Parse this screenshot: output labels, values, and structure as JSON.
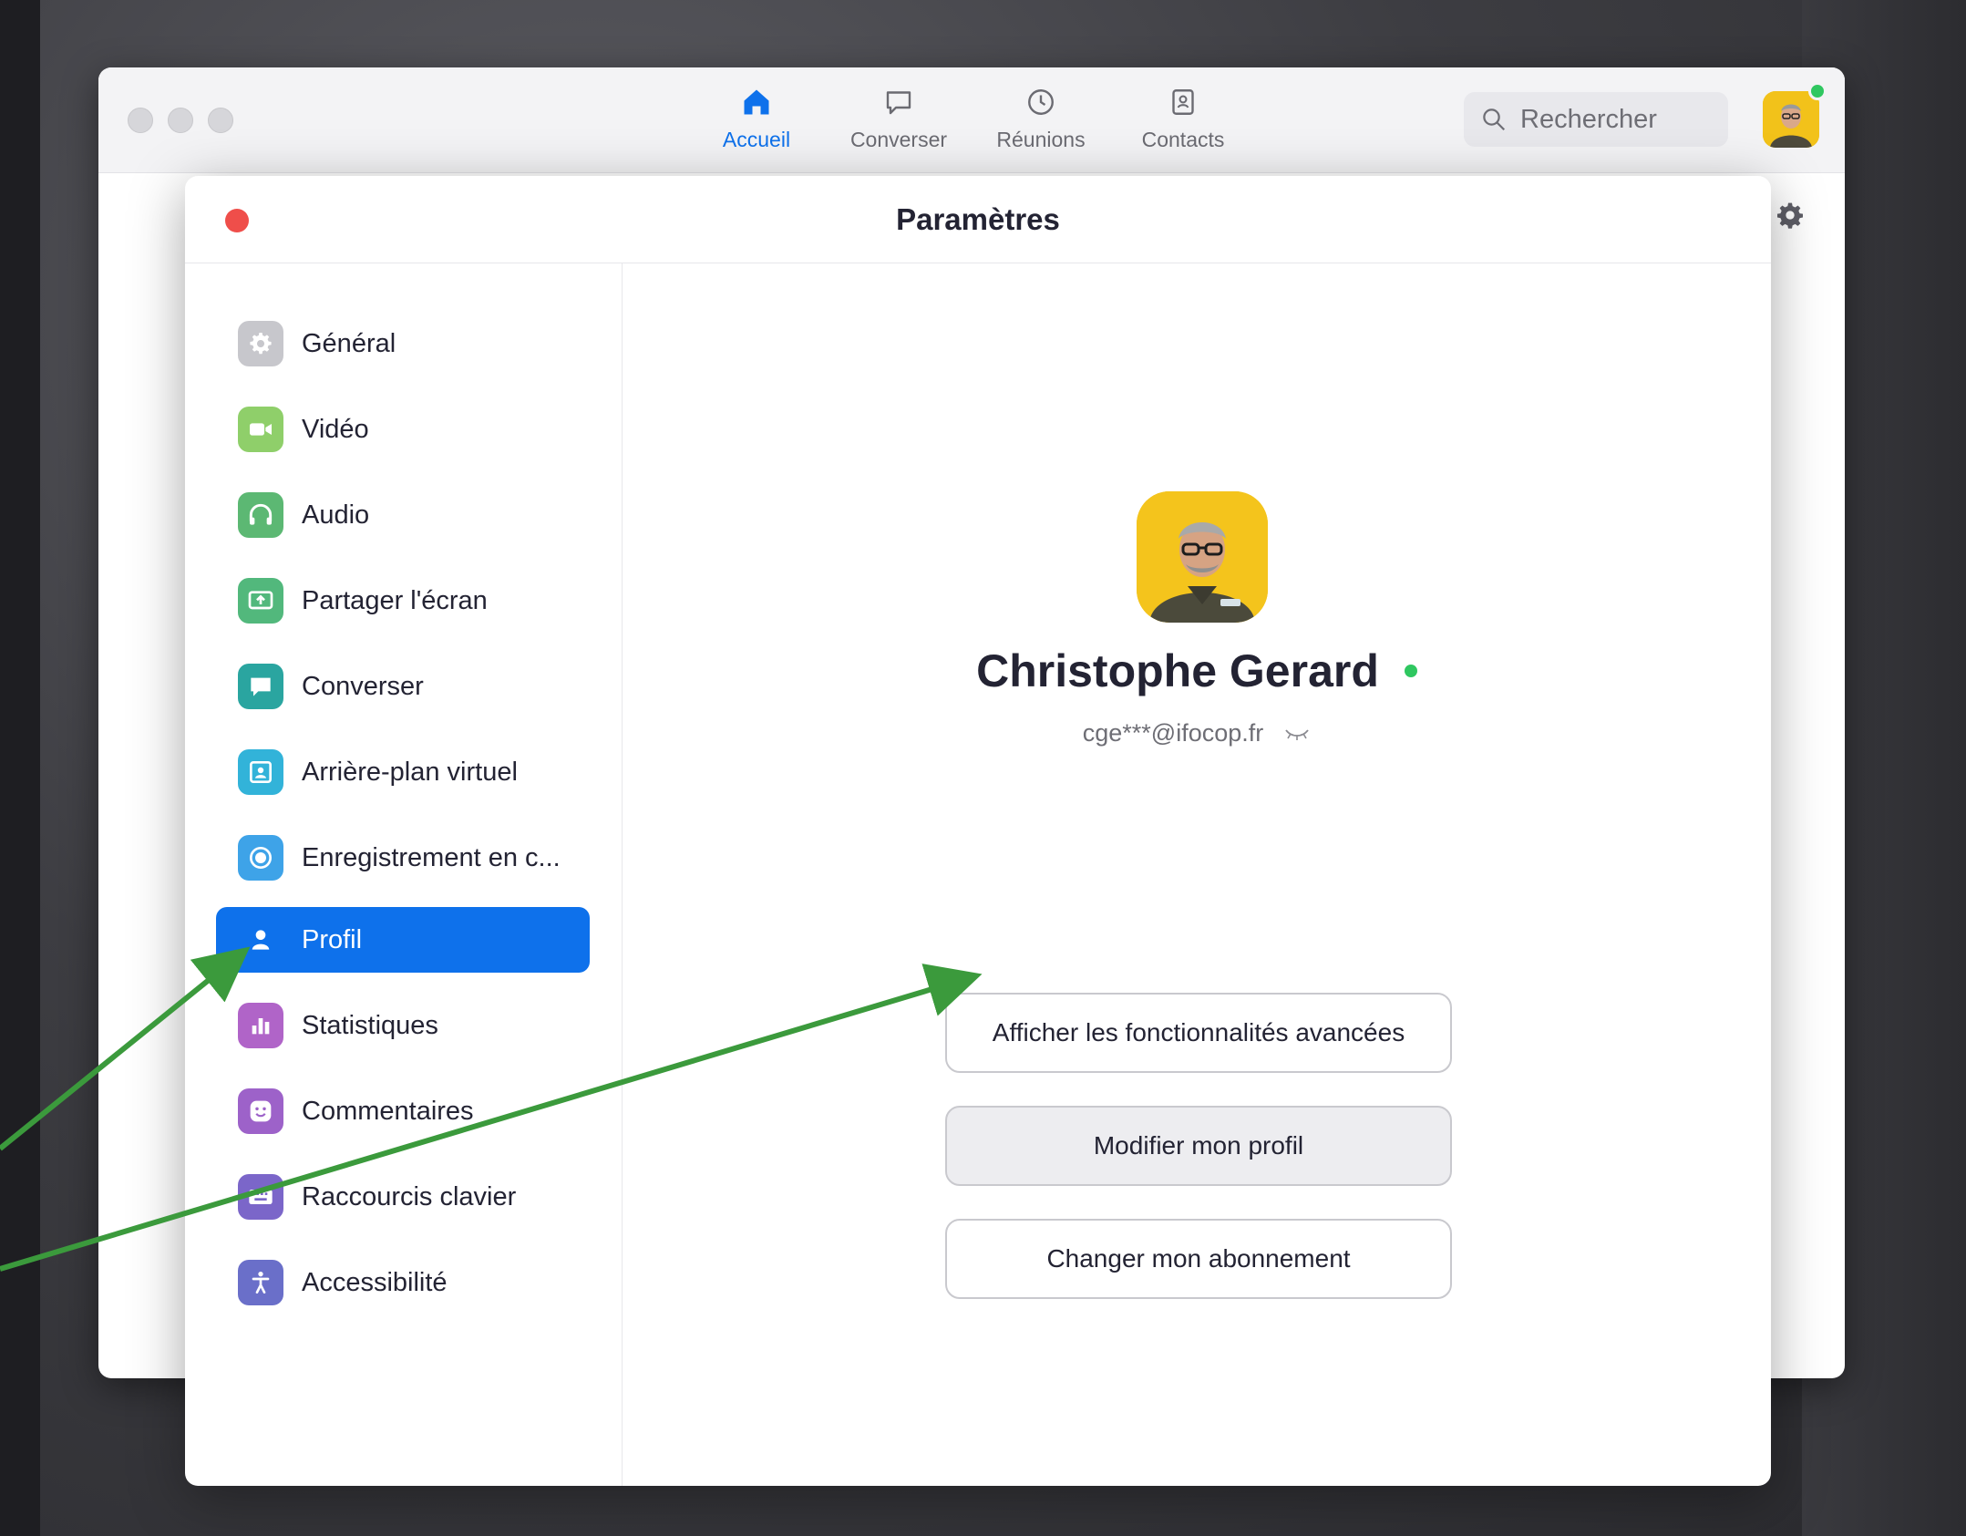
{
  "main_window": {
    "nav": [
      {
        "label": "Accueil",
        "icon": "home-icon",
        "active": true
      },
      {
        "label": "Converser",
        "icon": "chat-bubble-icon",
        "active": false
      },
      {
        "label": "Réunions",
        "icon": "clock-icon",
        "active": false
      },
      {
        "label": "Contacts",
        "icon": "contact-card-icon",
        "active": false
      }
    ],
    "search_placeholder": "Rechercher"
  },
  "settings": {
    "title": "Paramètres",
    "sidebar": [
      {
        "label": "Général",
        "icon": "gear-icon",
        "color": "#c7c7cc"
      },
      {
        "label": "Vidéo",
        "icon": "video-camera-icon",
        "color": "#8fcf6a"
      },
      {
        "label": "Audio",
        "icon": "headphones-icon",
        "color": "#5cb873"
      },
      {
        "label": "Partager l'écran",
        "icon": "share-screen-icon",
        "color": "#52b87c"
      },
      {
        "label": "Converser",
        "icon": "chat-bubble-icon",
        "color": "#2aa5a0"
      },
      {
        "label": "Arrière-plan virtuel",
        "icon": "virtual-background-icon",
        "color": "#32b3d9"
      },
      {
        "label": "Enregistrement en c...",
        "icon": "record-icon",
        "color": "#3ea3e8"
      },
      {
        "label": "Profil",
        "icon": "person-icon",
        "color": "#0e71eb",
        "active": true
      },
      {
        "label": "Statistiques",
        "icon": "bar-chart-icon",
        "color": "#b064c8"
      },
      {
        "label": "Commentaires",
        "icon": "smiley-icon",
        "color": "#9d62c9"
      },
      {
        "label": "Raccourcis clavier",
        "icon": "keyboard-icon",
        "color": "#7b66c9"
      },
      {
        "label": "Accessibilité",
        "icon": "accessibility-icon",
        "color": "#6a6fc9"
      }
    ],
    "profile": {
      "name": "Christophe Gerard",
      "email": "cge***@ifocop.fr",
      "buttons": [
        "Afficher les fonctionnalités avancées",
        "Modifier mon profil",
        "Changer mon abonnement"
      ]
    }
  },
  "colors": {
    "accent": "#0e71eb",
    "online": "#2fc760",
    "close": "#ef4e4a",
    "annotation_arrow": "#3b9a3c"
  }
}
